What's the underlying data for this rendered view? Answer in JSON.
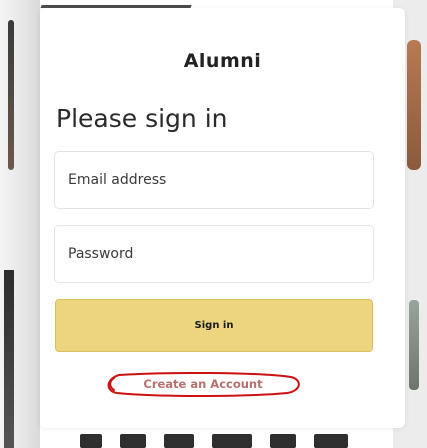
{
  "app": {
    "title": "Alumni"
  },
  "form": {
    "heading": "Please sign in",
    "email_placeholder": "Email address",
    "password_placeholder": "Password",
    "submit_label": "Sign in",
    "create_account_label": "Create an Account"
  },
  "colors": {
    "primary_button": "#ecd57e",
    "create_account_text": "#b76f6f",
    "create_account_outline": "#cc1111"
  }
}
